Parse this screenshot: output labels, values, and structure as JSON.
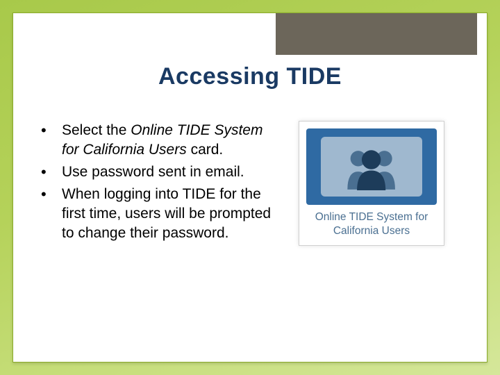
{
  "title": "Accessing TIDE",
  "bullets": [
    {
      "italic": "Select the ",
      "italic2": "Online TIDE System for California Users",
      "rest": " card."
    },
    {
      "plain": "Use password sent in email."
    },
    {
      "plain": "When logging into TIDE for the first time, users will be prompted to change their password."
    }
  ],
  "bullet1_prefix": "Select the ",
  "bullet1_italic": "Online TIDE System for California Users",
  "bullet1_suffix": " card.",
  "bullet2": "Use password sent in email.",
  "bullet3": "When logging into TIDE for the first time, users will be prompted to change their password.",
  "card": {
    "label": "Online TIDE System for California Users"
  },
  "colors": {
    "title": "#1a3a63",
    "header_block": "#6c665a",
    "card_blue": "#2f6aa3",
    "card_label": "#4a6f91",
    "slide_border": "#8aab2a"
  }
}
